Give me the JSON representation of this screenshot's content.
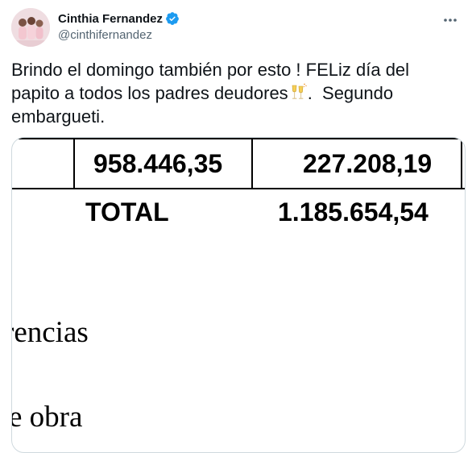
{
  "author": {
    "name": "Cinthia Fernandez",
    "handle": "@cinthifernandez",
    "verified": true,
    "avatar_icon": "avatar-photo-icon"
  },
  "tweet": {
    "text_part1": "Brindo el domingo también por esto ! FELiz día del papito a todos los padres deudores",
    "emoji_icon": "champagne-glasses-icon",
    "text_part2": ".  Segundo embargueti."
  },
  "document": {
    "row_value_1": "958.446,35",
    "row_value_2": "227.208,19",
    "total_label": "TOTAL",
    "total_value": "1.185.654,54",
    "fragment_1": "rencias",
    "fragment_2": "e  obra"
  },
  "colors": {
    "accent": "#1d9bf0",
    "secondary_text": "#536471",
    "border": "#cfd9de"
  }
}
